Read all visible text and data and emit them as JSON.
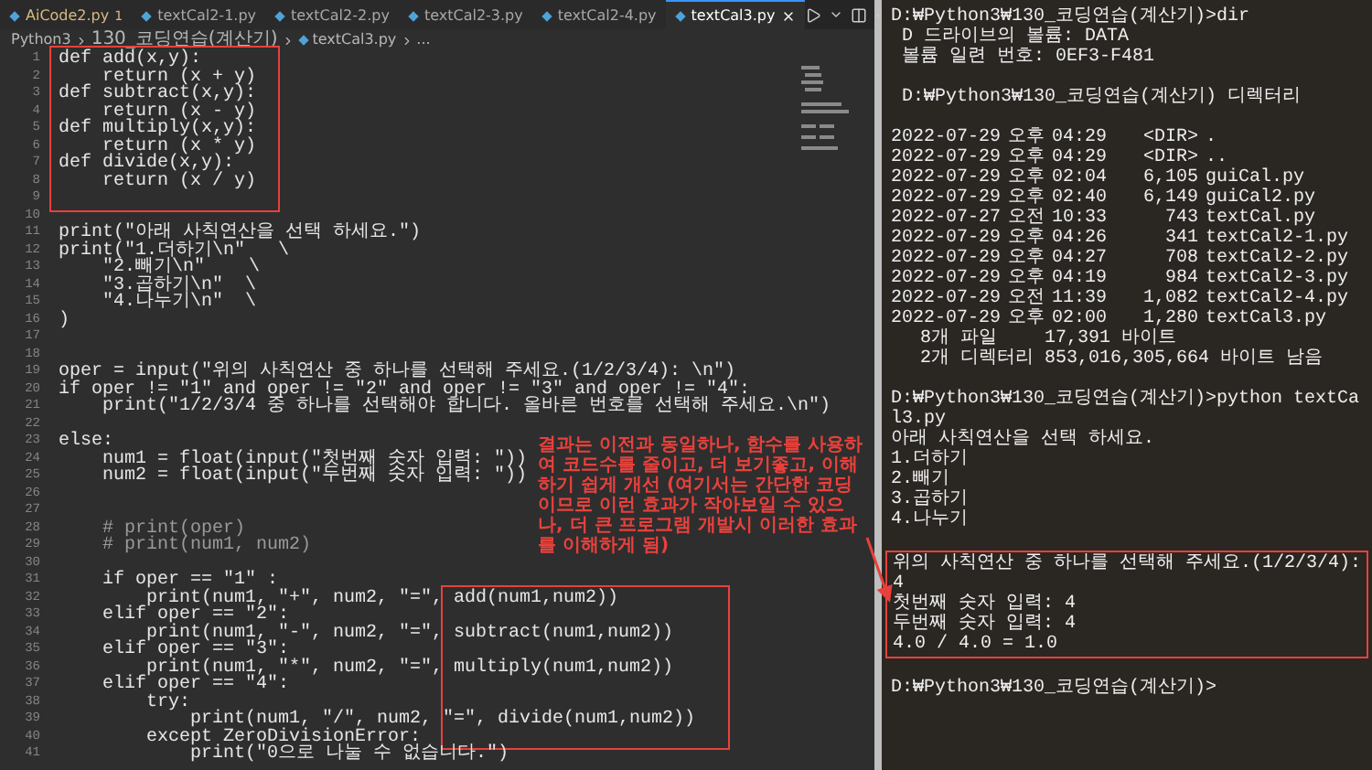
{
  "editor": {
    "tabs": [
      {
        "label": "AiCode2.py",
        "badge": "1",
        "warning": true,
        "selected": false
      },
      {
        "label": "textCal2-1.py",
        "warning": false,
        "selected": false
      },
      {
        "label": "textCal2-2.py",
        "warning": false,
        "selected": false
      },
      {
        "label": "textCal2-3.py",
        "warning": false,
        "selected": false
      },
      {
        "label": "textCal2-4.py",
        "warning": false,
        "selected": false
      },
      {
        "label": "textCal3.py",
        "warning": false,
        "selected": true
      }
    ],
    "breadcrumb": [
      "Python3",
      "130_코딩연습(계산기)",
      "textCal3.py",
      "..."
    ],
    "sections": [
      {
        "boxed": true,
        "lines": [
          {
            "n": "1",
            "code": "def add(x,y):"
          },
          {
            "n": "2",
            "code": "    return (x + y)"
          },
          {
            "n": "3",
            "code": "def subtract(x,y):"
          },
          {
            "n": "4",
            "code": "    return (x - y)"
          },
          {
            "n": "5",
            "code": "def multiply(x,y):"
          },
          {
            "n": "6",
            "code": "    return (x * y)"
          },
          {
            "n": "7",
            "code": "def divide(x,y):"
          },
          {
            "n": "8",
            "code": "    return (x / y)"
          },
          {
            "n": "9"
          }
        ]
      },
      {
        "boxed": false,
        "lines": [
          {
            "n": "10"
          },
          {
            "n": "11",
            "code": "print(\"아래 사칙연산을 선택 하세요.\")"
          },
          {
            "n": "12",
            "code": "print(\"1.더하기\\n\"   \\"
          },
          {
            "n": "13",
            "code": "    \"2.빼기\\n\"    \\"
          },
          {
            "n": "14",
            "code": "    \"3.곱하기\\n\"  \\"
          },
          {
            "n": "15",
            "code": "    \"4.나누기\\n\"  \\"
          },
          {
            "n": "16",
            "code": ")"
          },
          {
            "n": "17"
          },
          {
            "n": "18"
          },
          {
            "n": "19",
            "code": "oper = input(\"위의 사칙연산 중 하나를 선택해 주세요.(1/2/3/4): \\n\")"
          },
          {
            "n": "20",
            "code": "if oper != \"1\" and oper != \"2\" and oper != \"3\" and oper != \"4\":"
          },
          {
            "n": "21",
            "code": "    print(\"1/2/3/4 중 하나를 선택해야 합니다. 올바른 번호를 선택해 주세요.\\n\")"
          },
          {
            "n": "22"
          },
          {
            "n": "23",
            "code": "else:"
          },
          {
            "n": "24",
            "code": "    num1 = float(input(\"첫번째 숫자 입력: \"))"
          },
          {
            "n": "25",
            "code": "    num2 = float(input(\"두번째 숫자 입력: \"))"
          },
          {
            "n": "26"
          },
          {
            "n": "27"
          },
          {
            "n": "28",
            "code": "    # print(oper)",
            "kind": "comment"
          },
          {
            "n": "29",
            "code": "    # print(num1, num2)",
            "kind": "comment"
          },
          {
            "n": "30"
          },
          {
            "n": "31",
            "code": "    if oper == \"1\" :"
          }
        ]
      },
      {
        "boxed": true,
        "lines": [
          {
            "n": "32",
            "code": "        print(num1, \"+\", num2, \"=\", add(num1,num2))"
          },
          {
            "n": "33",
            "code": "    elif oper == \"2\":"
          },
          {
            "n": "34",
            "code": "        print(num1, \"-\", num2, \"=\", subtract(num1,num2))"
          },
          {
            "n": "35",
            "code": "    elif oper == \"3\":"
          },
          {
            "n": "36",
            "code": "        print(num1, \"*\", num2, \"=\", multiply(num1,num2))"
          },
          {
            "n": "37",
            "code": "    elif oper == \"4\":"
          },
          {
            "n": "38",
            "code": "        try:"
          },
          {
            "n": "39",
            "code": "            print(num1, \"/\", num2, \"=\", divide(num1,num2))"
          },
          {
            "n": "40",
            "code": "        except ZeroDivisionError:"
          }
        ]
      },
      {
        "boxed": false,
        "lines": [
          {
            "n": "41",
            "code": "            print(\"0으로 나눌 수 없습니다.\")"
          }
        ]
      }
    ],
    "note": "결과는 이전과 동일하나, 함수를 사용하여 코드수를 줄이고, 더 보기좋고, 이해하기 쉽게 개선 (여기서는 간단한 코딩이므로 이런 효과가 작아보일 수 있으나, 더 큰 프로그램 개발시 이러한 효과를 이해하게 됨)"
  },
  "terminal": {
    "sections": [
      {
        "boxed": false,
        "lines": [
          {
            "kind": "text",
            "text": "D:₩Python3₩130_코딩연습(계산기)>dir"
          },
          {
            "kind": "text",
            "text": " D 드라이브의 볼륨: DATA"
          },
          {
            "kind": "text",
            "text": " 볼륨 일련 번호: 0EF3-F481"
          },
          {
            "kind": "blank"
          },
          {
            "kind": "text",
            "text": " D:₩Python3₩130_코딩연습(계산기) 디렉터리"
          },
          {
            "kind": "blank"
          },
          {
            "kind": "entry",
            "date": "2022-07-29",
            "period": "오후",
            "time": "04:29",
            "size": "<DIR>",
            "name": "."
          },
          {
            "kind": "entry",
            "date": "2022-07-29",
            "period": "오후",
            "time": "04:29",
            "size": "<DIR>",
            "name": ".."
          },
          {
            "kind": "entry",
            "date": "2022-07-29",
            "period": "오후",
            "time": "02:04",
            "size": "6,105",
            "name": "guiCal.py"
          },
          {
            "kind": "entry",
            "date": "2022-07-29",
            "period": "오후",
            "time": "02:40",
            "size": "6,149",
            "name": "guiCal2.py"
          },
          {
            "kind": "entry",
            "date": "2022-07-27",
            "period": "오전",
            "time": "10:33",
            "size": "743",
            "name": "textCal.py"
          },
          {
            "kind": "entry",
            "date": "2022-07-29",
            "period": "오후",
            "time": "04:26",
            "size": "341",
            "name": "textCal2-1.py"
          },
          {
            "kind": "entry",
            "date": "2022-07-29",
            "period": "오후",
            "time": "04:27",
            "size": "708",
            "name": "textCal2-2.py"
          },
          {
            "kind": "entry",
            "date": "2022-07-29",
            "period": "오후",
            "time": "04:19",
            "size": "984",
            "name": "textCal2-3.py"
          },
          {
            "kind": "entry",
            "date": "2022-07-29",
            "period": "오전",
            "time": "11:39",
            "size": "1,082",
            "name": "textCal2-4.py"
          },
          {
            "kind": "entry",
            "date": "2022-07-29",
            "period": "오후",
            "time": "02:00",
            "size": "1,280",
            "name": "textCal3.py"
          },
          {
            "kind": "summary",
            "count": "8개 파일",
            "size": "17,391 바이트"
          },
          {
            "kind": "summary",
            "count": "2개 디렉터리",
            "size": "853,016,305,664 바이트 남음"
          },
          {
            "kind": "blank"
          },
          {
            "kind": "text",
            "text": "D:₩Python3₩130_코딩연습(계산기)>python textCal3.py"
          },
          {
            "kind": "text",
            "text": "아래 사칙연산을 선택 하세요."
          },
          {
            "kind": "text",
            "text": "1.더하기"
          },
          {
            "kind": "text",
            "text": "2.빼기"
          },
          {
            "kind": "text",
            "text": "3.곱하기"
          },
          {
            "kind": "text",
            "text": "4.나누기"
          },
          {
            "kind": "blank"
          }
        ]
      },
      {
        "boxed": true,
        "lines": [
          {
            "kind": "text",
            "text": "위의 사칙연산 중 하나를 선택해 주세요.(1/2/3/4):"
          },
          {
            "kind": "text",
            "text": "4"
          },
          {
            "kind": "text",
            "text": "첫번째 숫자 입력: 4"
          },
          {
            "kind": "text",
            "text": "두번째 숫자 입력: 4"
          },
          {
            "kind": "text",
            "text": "4.0 / 4.0 = 1.0"
          }
        ]
      },
      {
        "boxed": false,
        "lines": [
          {
            "kind": "blank"
          },
          {
            "kind": "text",
            "text": "D:₩Python3₩130_코딩연습(계산기)>"
          }
        ]
      }
    ]
  }
}
